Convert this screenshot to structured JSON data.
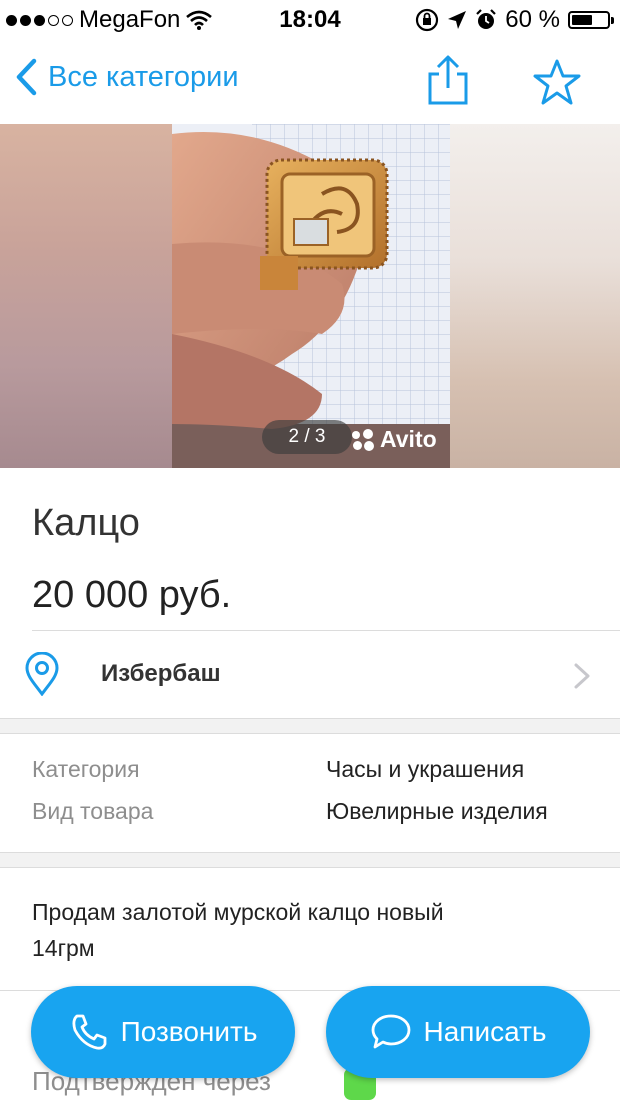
{
  "status_bar": {
    "carrier": "MegaFon",
    "time": "18:04",
    "battery_percent": "60 %",
    "battery_level": 0.6,
    "signal_dots_filled": 3,
    "signal_dots_total": 5
  },
  "nav": {
    "back_label": "Все категории"
  },
  "gallery": {
    "counter": "2 / 3",
    "watermark": "Avito"
  },
  "listing": {
    "title": "Калцо",
    "price": "20 000 руб.",
    "location": "Избербаш",
    "params": [
      {
        "key": "Категория",
        "value": "Часы и украшения"
      },
      {
        "key": "Вид товара",
        "value": "Ювелирные изделия"
      }
    ],
    "description": "Продам залотой  мурской калцо новый\n14грм",
    "verified_text": "Подтвержден через"
  },
  "actions": {
    "call_label": "Позвонить",
    "message_label": "Написать"
  },
  "colors": {
    "accent": "#1a9be8",
    "button": "#18a4f0",
    "verified": "#5ed84a"
  },
  "icons": [
    "back-chevron-icon",
    "share-icon",
    "star-icon",
    "location-pin-icon",
    "chevron-right-icon",
    "phone-icon",
    "chat-bubble-icon",
    "whatsapp-icon"
  ]
}
